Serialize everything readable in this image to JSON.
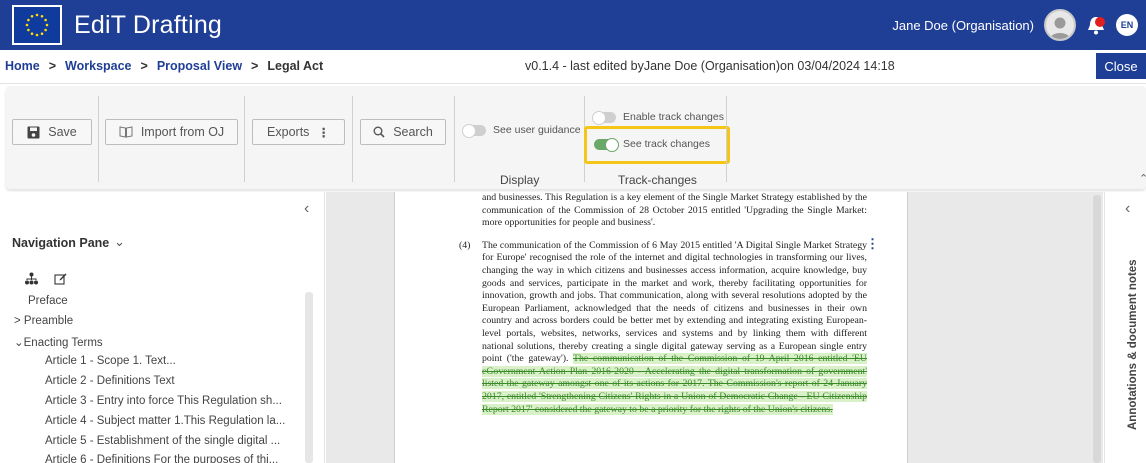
{
  "header": {
    "app_title": "EdiT Drafting",
    "user_name": "Jane Doe (Organisation)",
    "language": "EN",
    "brand_color": "#1f3f96",
    "icons": [
      "eu-flag-logo",
      "user-avatar-icon",
      "notification-bell-icon",
      "language-icon"
    ]
  },
  "breadcrumb": {
    "home": "Home",
    "workspace": "Workspace",
    "proposal_view": "Proposal View",
    "current": "Legal Act"
  },
  "version_info": "v0.1.4 - last edited byJane Doe (Organisation)on 03/04/2024 14:18",
  "close_label": "Close",
  "toolbar": {
    "save": "Save",
    "import": "Import from OJ",
    "exports": "Exports",
    "search": "Search",
    "see_user_guidance": "See user guidance",
    "display_label": "Display",
    "enable_track_changes": "Enable track changes",
    "see_track_changes": "See track changes",
    "track_changes_label": "Track-changes",
    "see_user_guidance_on": false,
    "enable_track_changes_on": false,
    "see_track_changes_on": true,
    "highlight_color": "#f5c518"
  },
  "nav": {
    "title": "Navigation Pane",
    "items": [
      "Preface",
      "Preamble",
      "Enacting Terms",
      "Article 1 - Scope 1. Text...",
      "Article 2 - Definitions Text",
      "Article 3 - Entry into force This Regulation sh...",
      "Article 4 - Subject matter 1.This Regulation la...",
      "Article 5 - Establishment of the single digital ...",
      "Article 6 - Definitions For the purposes of thi..."
    ]
  },
  "document": {
    "intro": "and businesses. This Regulation is a key element of the Single Market Strategy established by the communication of the Commission of 28 October 2015 entitled 'Upgrading the Single Market: more opportunities for people and business'.",
    "para_num": "(4)",
    "para_text": "The communication of the Commission of 6 May 2015 entitled 'A Digital Single Market Strategy for Europe' recognised the role of the internet and digital technologies in transforming our lives, changing the way in which citizens and businesses access information, acquire knowledge, buy goods and services, participate in the market and work, thereby facilitating opportunities for innovation, growth and jobs. That communication, along with several resolutions adopted by the European Parliament, acknowledged that the needs of citizens and businesses in their own country and across borders could be better met by extending and integrating existing European-level portals, websites, networks, services and systems and by linking them with different national solutions, thereby creating a single digital gateway serving as a European single entry point ('the gateway').",
    "para_deleted": "The communication of the Commission of 19 April 2016 entitled 'EU eGovernment Action Plan 2016-2020 - Accelerating the digital transformation of government' listed the gateway amongst one of its actions for 2017. The Commission's report of 24 January 2017, entitled 'Strengthening Citizens' Rights in a Union of Democratic Change - EU Citizenship Report 2017' considered the gateway to be a priority for the rights of the Union's citizens."
  },
  "annotations_label": "Annotations & document notes"
}
